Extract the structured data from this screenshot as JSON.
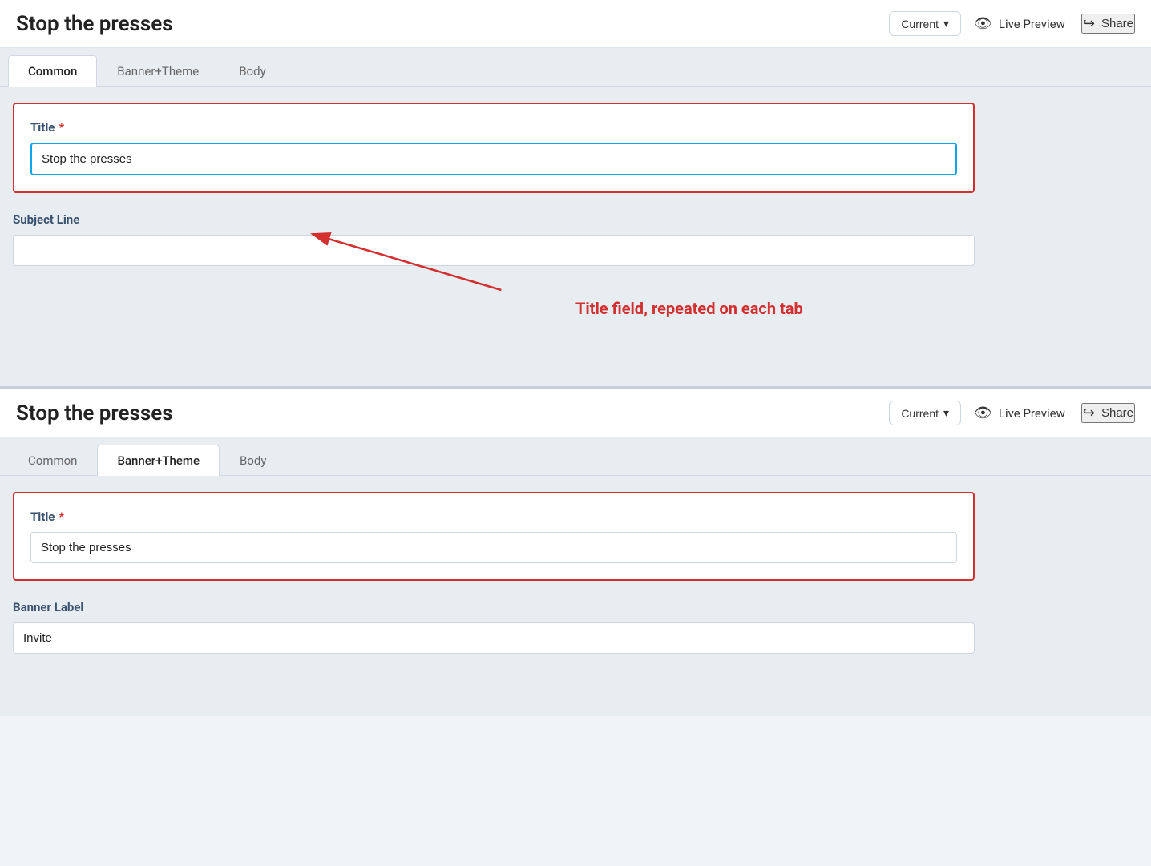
{
  "page": {
    "title": "Stop the presses"
  },
  "panel1": {
    "header": {
      "title": "Stop the presses",
      "version_label": "Current",
      "version_chevron": "▾",
      "live_preview_label": "Live Preview",
      "share_label": "Share"
    },
    "tabs": [
      {
        "id": "common",
        "label": "Common",
        "active": true
      },
      {
        "id": "banner-theme",
        "label": "Banner+Theme",
        "active": false
      },
      {
        "id": "body",
        "label": "Body",
        "active": false
      }
    ],
    "form": {
      "title_label": "Title",
      "title_required": "*",
      "title_value": "Stop the presses",
      "subject_label": "Subject Line",
      "subject_value": ""
    }
  },
  "annotation": {
    "text": "Title field, repeated on each tab"
  },
  "panel2": {
    "header": {
      "title": "Stop the presses",
      "version_label": "Current",
      "version_chevron": "▾",
      "live_preview_label": "Live Preview",
      "share_label": "Share"
    },
    "tabs": [
      {
        "id": "common",
        "label": "Common",
        "active": false
      },
      {
        "id": "banner-theme",
        "label": "Banner+Theme",
        "active": true
      },
      {
        "id": "body",
        "label": "Body",
        "active": false
      }
    ],
    "form": {
      "title_label": "Title",
      "title_required": "*",
      "title_value": "Stop the presses",
      "banner_label": "Banner Label",
      "banner_value": "Invite"
    }
  },
  "icons": {
    "eye": "👁",
    "share": "↪",
    "chevron_down": "∨"
  }
}
